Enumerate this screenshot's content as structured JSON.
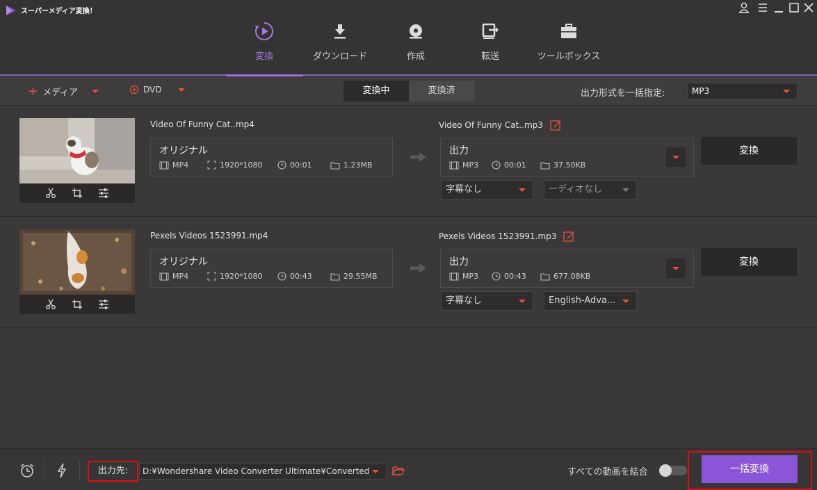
{
  "app": {
    "title": "スーパーメディア変換！"
  },
  "nav": [
    {
      "label": "変換",
      "icon": "convert-icon"
    },
    {
      "label": "ダウンロード",
      "icon": "download-icon"
    },
    {
      "label": "作成",
      "icon": "disc-icon"
    },
    {
      "label": "転送",
      "icon": "transfer-icon"
    },
    {
      "label": "ツールボックス",
      "icon": "toolbox-icon"
    }
  ],
  "toolbar": {
    "media_label": "メディア",
    "dvd_label": "DVD",
    "tab_converting": "変換中",
    "tab_converted": "変換済",
    "format_label": "出力形式を一括指定:",
    "format_value": "MP3"
  },
  "files": [
    {
      "src_name": "Video Of Funny Cat..mp4",
      "src_title": "オリジナル",
      "src_format": "MP4",
      "src_resolution": "1920*1080",
      "src_duration": "00:01",
      "src_size": "1.23MB",
      "dst_name": "Video Of Funny Cat..mp3",
      "dst_title": "出力",
      "dst_format": "MP3",
      "dst_duration": "00:01",
      "dst_size": "37.50KB",
      "convert_label": "変換",
      "subtitle": "字幕なし",
      "audio": "ーディオなし"
    },
    {
      "src_name": "Pexels Videos 1523991.mp4",
      "src_title": "オリジナル",
      "src_format": "MP4",
      "src_resolution": "1920*1080",
      "src_duration": "00:43",
      "src_size": "29.55MB",
      "dst_name": "Pexels Videos 1523991.mp3",
      "dst_title": "出力",
      "dst_format": "MP3",
      "dst_duration": "00:43",
      "dst_size": "677.08KB",
      "convert_label": "変換",
      "subtitle": "字幕なし",
      "audio": "English-Adva..."
    }
  ],
  "bottom": {
    "output_label": "出力先:",
    "output_path": "D:¥Wondershare Video Converter Ultimate¥Converted",
    "merge_label": "すべての動画を結合",
    "batch_label": "一括変換"
  },
  "colors": {
    "accent": "#8a55d6",
    "highlight": "#e01010",
    "caret": "#e0543e"
  }
}
